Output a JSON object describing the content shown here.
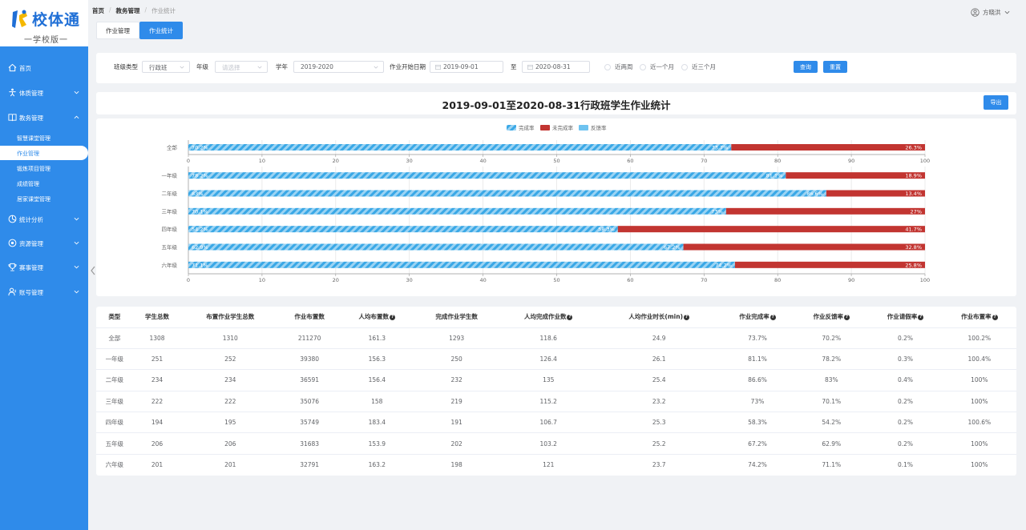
{
  "app": {
    "logo_title": "校体通",
    "logo_subtitle": "一学校版一",
    "user_name": "方晓洪"
  },
  "sidebar": {
    "items": [
      {
        "label": "首页",
        "icon": "home-icon"
      },
      {
        "label": "体质管理",
        "icon": "fitness-icon"
      },
      {
        "label": "教务管理",
        "icon": "book-icon"
      },
      {
        "label": "统计分析",
        "icon": "chart-icon"
      },
      {
        "label": "资源管理",
        "icon": "resource-icon"
      },
      {
        "label": "赛事管理",
        "icon": "trophy-icon"
      },
      {
        "label": "账号管理",
        "icon": "account-icon"
      }
    ],
    "subitems": [
      "智慧课堂管理",
      "作业管理",
      "锻炼项目管理",
      "成绩管理",
      "居家课堂管理"
    ]
  },
  "breadcrumb": [
    "首页",
    "教务管理",
    "作业统计"
  ],
  "tabs": [
    "作业管理",
    "作业统计"
  ],
  "filters": {
    "class_type_label": "班级类型",
    "class_type_value": "行政班",
    "grade_label": "年级",
    "grade_placeholder": "请选择",
    "year_label": "学年",
    "year_value": "2019-2020",
    "start_label": "作业开始日期",
    "start_date": "2019-09-01",
    "to_label": "至",
    "end_date": "2020-08-31",
    "radio_options": [
      "近两周",
      "近一个月",
      "近三个月"
    ],
    "query_label": "查询",
    "reset_label": "重置"
  },
  "chart_title": "2019-09-01至2020-08-31行政班学生作业统计",
  "export_label": "导出",
  "colors": {
    "accent": "#2f8bea",
    "complete": "#3aa8e6",
    "incomplete": "#c23531"
  },
  "chart_data": {
    "type": "bar",
    "orientation": "horizontal",
    "stacked": true,
    "legend": [
      "完成率",
      "未完成率",
      "反馈率"
    ],
    "legend_position": "top-center",
    "xlim": [
      0,
      100
    ],
    "x_ticks": [
      0,
      10,
      20,
      30,
      40,
      50,
      60,
      70,
      80,
      90,
      100
    ],
    "groups": [
      {
        "categories": [
          "全部"
        ],
        "series": [
          {
            "name": "完成率",
            "values": [
              73.7
            ]
          },
          {
            "name": "未完成率",
            "values": [
              26.3
            ]
          },
          {
            "name": "反馈率",
            "values": [
              70.2
            ]
          }
        ]
      },
      {
        "categories": [
          "一年级",
          "二年级",
          "三年级",
          "四年级",
          "五年级",
          "六年级"
        ],
        "series": [
          {
            "name": "完成率",
            "values": [
              81.1,
              86.6,
              73,
              58.3,
              67.2,
              74.2
            ]
          },
          {
            "name": "未完成率",
            "values": [
              18.9,
              13.4,
              27.0,
              41.7,
              32.8,
              25.8
            ]
          },
          {
            "name": "反馈率",
            "values": [
              78.2,
              83,
              70.1,
              54.2,
              62.9,
              71.1
            ]
          }
        ]
      }
    ],
    "grid": true
  },
  "table": {
    "headers": [
      {
        "text": "类型",
        "q": false
      },
      {
        "text": "学生总数",
        "q": false
      },
      {
        "text": "布置作业学生总数",
        "q": false
      },
      {
        "text": "作业布置数",
        "q": false
      },
      {
        "text": "人均布置数",
        "q": true
      },
      {
        "text": "完成作业学生数",
        "q": false
      },
      {
        "text": "人均完成作业数",
        "q": true
      },
      {
        "text": "人均作业时长(min)",
        "q": true
      },
      {
        "text": "作业完成率",
        "q": true
      },
      {
        "text": "作业反馈率",
        "q": true
      },
      {
        "text": "作业请假率",
        "q": true
      },
      {
        "text": "作业布置率",
        "q": true
      }
    ],
    "rows": [
      [
        "全部",
        "1308",
        "1310",
        "211270",
        "161.3",
        "1293",
        "118.6",
        "24.9",
        "73.7%",
        "70.2%",
        "0.2%",
        "100.2%"
      ],
      [
        "一年级",
        "251",
        "252",
        "39380",
        "156.3",
        "250",
        "126.4",
        "26.1",
        "81.1%",
        "78.2%",
        "0.3%",
        "100.4%"
      ],
      [
        "二年级",
        "234",
        "234",
        "36591",
        "156.4",
        "232",
        "135",
        "25.4",
        "86.6%",
        "83%",
        "0.4%",
        "100%"
      ],
      [
        "三年级",
        "222",
        "222",
        "35076",
        "158",
        "219",
        "115.2",
        "23.2",
        "73%",
        "70.1%",
        "0.2%",
        "100%"
      ],
      [
        "四年级",
        "194",
        "195",
        "35749",
        "183.4",
        "191",
        "106.7",
        "25.3",
        "58.3%",
        "54.2%",
        "0.2%",
        "100.6%"
      ],
      [
        "五年级",
        "206",
        "206",
        "31683",
        "153.9",
        "202",
        "103.2",
        "25.2",
        "67.2%",
        "62.9%",
        "0.2%",
        "100%"
      ],
      [
        "六年级",
        "201",
        "201",
        "32791",
        "163.2",
        "198",
        "121",
        "23.7",
        "74.2%",
        "71.1%",
        "0.1%",
        "100%"
      ]
    ]
  }
}
